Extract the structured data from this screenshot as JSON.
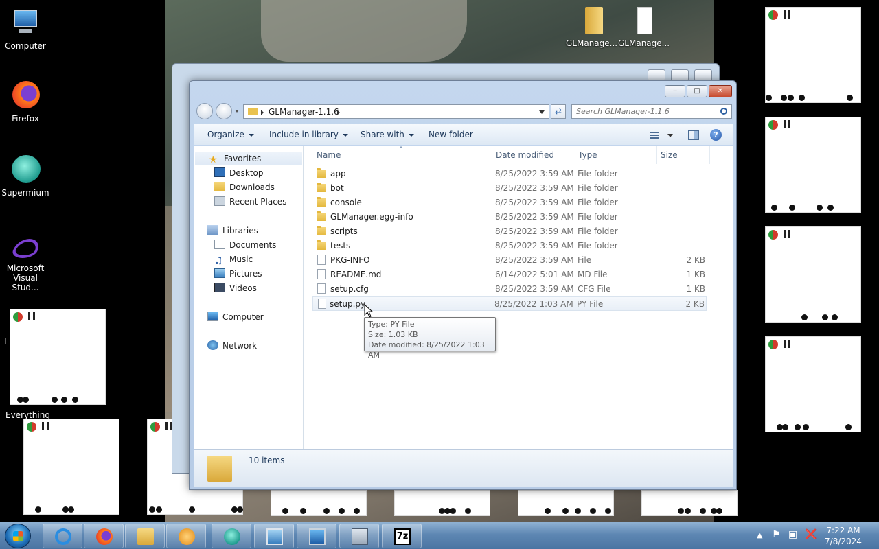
{
  "desktop": {
    "icons": [
      {
        "label": "Computer"
      },
      {
        "label": "Firefox"
      },
      {
        "label": "Supermium"
      },
      {
        "label": "Microsoft Visual Stud..."
      },
      {
        "label": "GLManage..."
      },
      {
        "label": "GLManage..."
      }
    ],
    "partial_labels": [
      "Everything",
      "I"
    ]
  },
  "explorer": {
    "address": {
      "folder": "GLManager-1.1.6"
    },
    "search": {
      "placeholder": "Search GLManager-1.1.6"
    },
    "toolbar": {
      "organize": "Organize",
      "include_in_library": "Include in library",
      "share_with": "Share with",
      "new_folder": "New folder",
      "help": "?"
    },
    "nav": {
      "favorites": "Favorites",
      "desktop": "Desktop",
      "downloads": "Downloads",
      "recent_places": "Recent Places",
      "libraries": "Libraries",
      "documents": "Documents",
      "music": "Music",
      "pictures": "Pictures",
      "videos": "Videos",
      "computer": "Computer",
      "network": "Network"
    },
    "columns": {
      "name": "Name",
      "date": "Date modified",
      "type": "Type",
      "size": "Size"
    },
    "files": [
      {
        "name": "app",
        "date": "8/25/2022 3:59 AM",
        "type": "File folder",
        "size": "",
        "kind": "folder"
      },
      {
        "name": "bot",
        "date": "8/25/2022 3:59 AM",
        "type": "File folder",
        "size": "",
        "kind": "folder"
      },
      {
        "name": "console",
        "date": "8/25/2022 3:59 AM",
        "type": "File folder",
        "size": "",
        "kind": "folder"
      },
      {
        "name": "GLManager.egg-info",
        "date": "8/25/2022 3:59 AM",
        "type": "File folder",
        "size": "",
        "kind": "folder"
      },
      {
        "name": "scripts",
        "date": "8/25/2022 3:59 AM",
        "type": "File folder",
        "size": "",
        "kind": "folder"
      },
      {
        "name": "tests",
        "date": "8/25/2022 3:59 AM",
        "type": "File folder",
        "size": "",
        "kind": "folder"
      },
      {
        "name": "PKG-INFO",
        "date": "8/25/2022 3:59 AM",
        "type": "File",
        "size": "2 KB",
        "kind": "file"
      },
      {
        "name": "README.md",
        "date": "6/14/2022 5:01 AM",
        "type": "MD File",
        "size": "1 KB",
        "kind": "file"
      },
      {
        "name": "setup.cfg",
        "date": "8/25/2022 3:59 AM",
        "type": "CFG File",
        "size": "1 KB",
        "kind": "file"
      },
      {
        "name": "setup.py",
        "date": "8/25/2022 1:03 AM",
        "type": "PY File",
        "size": "2 KB",
        "kind": "file"
      }
    ],
    "tooltip": {
      "type": "Type: PY File",
      "size": "Size: 1.03 KB",
      "date": "Date modified: 8/25/2022 1:03 AM"
    },
    "status": {
      "items": "10 items"
    }
  },
  "taskbar": {
    "clock": {
      "time": "7:22 AM",
      "date": "7/8/2024"
    },
    "sevenzip_label": "7z"
  }
}
